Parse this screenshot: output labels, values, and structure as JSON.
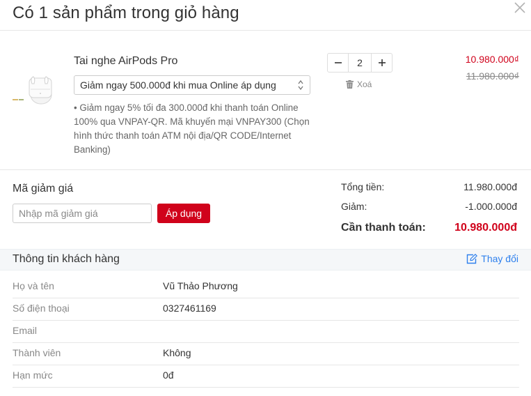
{
  "header": {
    "title": "Có 1 sản phẩm trong giỏ hàng",
    "close_icon": "close-icon"
  },
  "product": {
    "name": "Tai nghe AirPods Pro",
    "promo_selected": "Giảm ngay 500.000đ khi mua Online áp dụng",
    "promo_note": "• Giảm ngay 5% tối đa 300.000đ khi thanh toán Online 100% qua VNPAY-QR. Mã khuyến mại VNPAY300 (Chọn hình thức thanh toán ATM nội địa/QR CODE/Internet Banking)",
    "quantity": "2",
    "delete_label": "Xoá",
    "price": "10.980.000₫",
    "old_price": "11.980.000₫",
    "icons": {
      "minus": "minus-icon",
      "plus": "plus-icon",
      "trash": "trash-icon",
      "select": "select-arrows-icon"
    }
  },
  "coupon": {
    "label": "Mã giảm giá",
    "placeholder": "Nhập mã giảm giá",
    "apply_label": "Áp dụng"
  },
  "summary": {
    "total_label": "Tổng tiền:",
    "total_value": "11.980.000đ",
    "discount_label": "Giảm:",
    "discount_value": "-1.000.000đ",
    "payable_label": "Cần thanh toán:",
    "payable_value": "10.980.000đ"
  },
  "customer": {
    "title": "Thông tin khách hàng",
    "edit_label": "Thay đổi",
    "rows": [
      {
        "label": "Họ và tên",
        "value": "Vũ Thảo Phương"
      },
      {
        "label": "Số điện thoại",
        "value": "0327461169"
      },
      {
        "label": "Email",
        "value": ""
      },
      {
        "label": "Thành viên",
        "value": "Không"
      },
      {
        "label": "Hạn mức",
        "value": "0đ"
      }
    ]
  },
  "colors": {
    "accent": "#d0021b",
    "link": "#2f80ed",
    "muted": "#888888",
    "section_bg": "#f5f7f9"
  }
}
